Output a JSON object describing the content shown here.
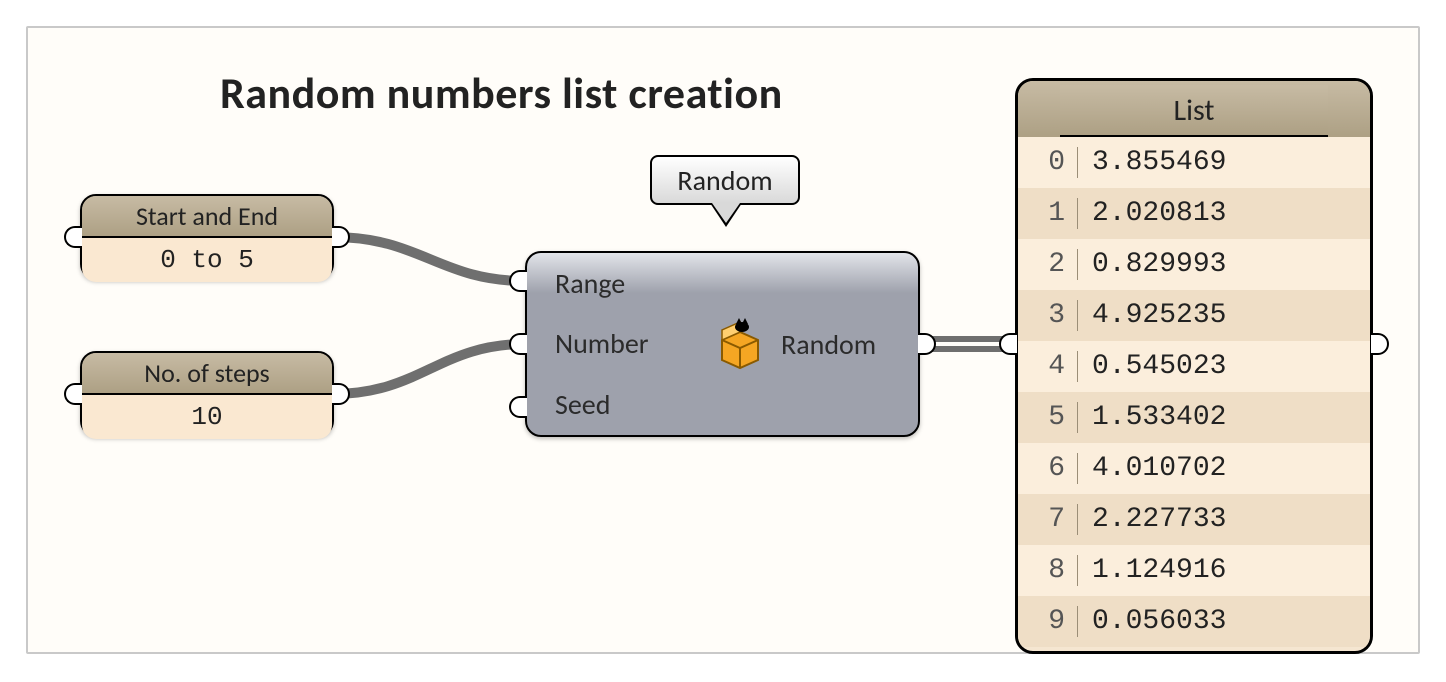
{
  "title": "Random numbers list creation",
  "tooltip": "Random",
  "range_node": {
    "header": "Start and End",
    "value": "0 to 5"
  },
  "steps_node": {
    "header": "No. of steps",
    "value": "10"
  },
  "random_node": {
    "in_range": "Range",
    "in_number": "Number",
    "in_seed": "Seed",
    "out_random": "Random"
  },
  "list_panel": {
    "header": "List",
    "rows": [
      {
        "index": "0",
        "value": "3.855469"
      },
      {
        "index": "1",
        "value": "2.020813"
      },
      {
        "index": "2",
        "value": "0.829993"
      },
      {
        "index": "3",
        "value": "4.925235"
      },
      {
        "index": "4",
        "value": "0.545023"
      },
      {
        "index": "5",
        "value": "1.533402"
      },
      {
        "index": "6",
        "value": "4.010702"
      },
      {
        "index": "7",
        "value": "2.227733"
      },
      {
        "index": "8",
        "value": "1.124916"
      },
      {
        "index": "9",
        "value": "0.056033"
      }
    ]
  }
}
